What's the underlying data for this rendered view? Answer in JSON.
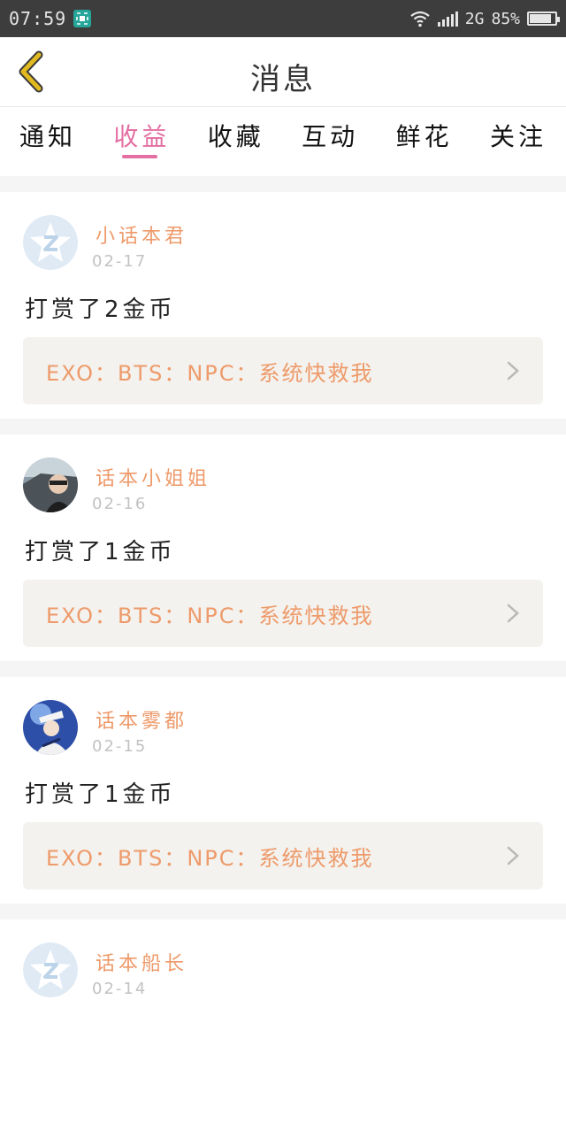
{
  "status_bar": {
    "time": "07:59",
    "network": "2G",
    "battery": "85%",
    "battery_level": 0.85
  },
  "header": {
    "title": "消息",
    "back_icon": "chevron-left-icon"
  },
  "tabs": [
    {
      "label": "通知",
      "active": false
    },
    {
      "label": "收益",
      "active": true
    },
    {
      "label": "收藏",
      "active": false
    },
    {
      "label": "互动",
      "active": false
    },
    {
      "label": "鲜花",
      "active": false
    },
    {
      "label": "关注",
      "active": false
    }
  ],
  "messages": [
    {
      "username": "小话本君",
      "date": "02-17",
      "reward": "打赏了2金币",
      "book": "EXO：BTS：NPC：系统快救我",
      "avatar": "default-avatar"
    },
    {
      "username": "话本小姐姐",
      "date": "02-16",
      "reward": "打赏了1金币",
      "book": "EXO：BTS：NPC：系统快救我",
      "avatar": "photo-avatar-car"
    },
    {
      "username": "话本雾都",
      "date": "02-15",
      "reward": "打赏了1金币",
      "book": "EXO：BTS：NPC：系统快救我",
      "avatar": "photo-avatar-anime"
    },
    {
      "username": "话本船长",
      "date": "02-14",
      "reward": "",
      "book": "",
      "avatar": "default-avatar"
    }
  ],
  "colors": {
    "accent": "#e46fa2",
    "username": "#ee9a6a",
    "back_arrow": "#e2b91f"
  }
}
